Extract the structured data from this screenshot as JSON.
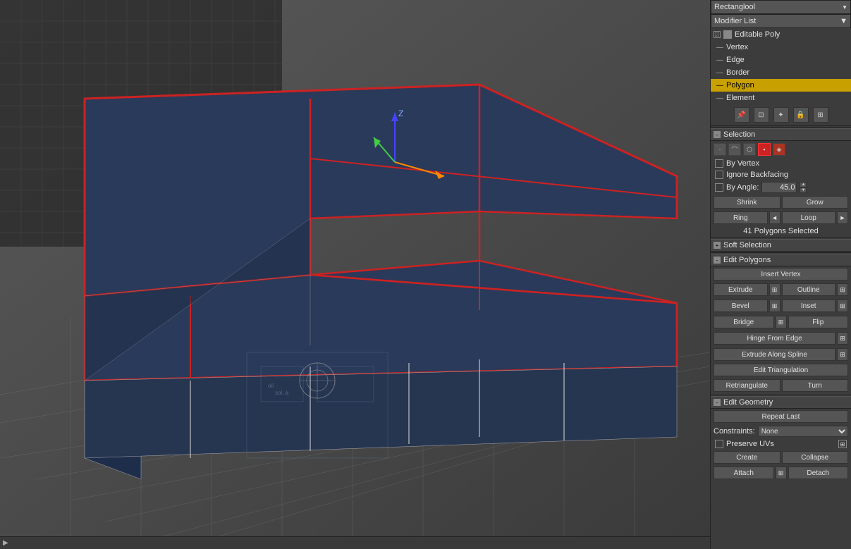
{
  "header": {
    "dropdown_value": "Rectanglool",
    "modifier_list_label": "Modifier List"
  },
  "modifier_stack": {
    "editable_poly": "Editable Poly",
    "vertex": "Vertex",
    "edge": "Edge",
    "border": "Border",
    "polygon": "Polygon",
    "element": "Element"
  },
  "toolbar": {
    "icons": [
      "⊕",
      "⊕",
      "↩",
      "🔒",
      "⊡"
    ]
  },
  "selection": {
    "title": "Selection",
    "by_vertex_label": "By Vertex",
    "ignore_backfacing_label": "Ignore Backfacing",
    "by_angle_label": "By Angle:",
    "by_angle_value": "45.0",
    "shrink_label": "Shrink",
    "grow_label": "Grow",
    "ring_label": "Ring",
    "loop_label": "Loop",
    "status": "41 Polygons Selected"
  },
  "soft_selection": {
    "title": "Soft Selection"
  },
  "edit_polygons": {
    "title": "Edit Polygons",
    "insert_vertex": "Insert Vertex",
    "extrude": "Extrude",
    "outline": "Outline",
    "bevel": "Bevel",
    "inset": "Inset",
    "bridge": "Bridge",
    "flip": "Flip",
    "hinge_from_edge": "Hinge From Edge",
    "extrude_along_spline": "Extrude Along Spline",
    "edit_triangulation": "Edit Triangulation",
    "retriangulate": "Retriangulate",
    "turn": "Turn"
  },
  "edit_geometry": {
    "title": "Edit Geometry",
    "repeat_last": "Repeat Last",
    "constraints_label": "Constraints:",
    "constraints_value": "None",
    "preserve_uvs_label": "Preserve UVs",
    "create_label": "Create",
    "collapse_label": "Collapse",
    "attach_label": "Attach",
    "detach_label": "Detach"
  },
  "colors": {
    "active_polygon": "#cc2222",
    "selected_highlight": "#c8a000",
    "panel_bg": "#3c3c3c",
    "button_bg": "#555555"
  }
}
